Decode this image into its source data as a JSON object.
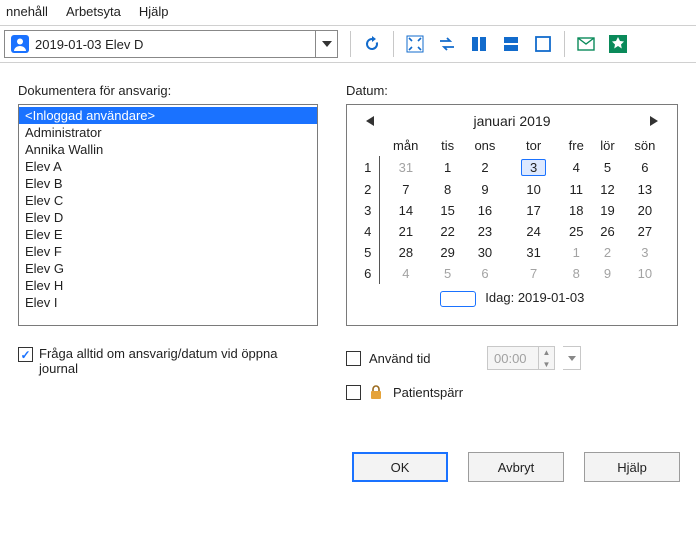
{
  "menubar": [
    "nnehåll",
    "Arbetsyta",
    "Hjälp"
  ],
  "toolbar": {
    "dropdown_text": "2019-01-03  Elev D"
  },
  "left": {
    "label": "Dokumentera för ansvarig:",
    "items": [
      "<Inloggad användare>",
      "Administrator",
      "Annika Wallin",
      "Elev A",
      "Elev B",
      "Elev C",
      "Elev D",
      "Elev E",
      "Elev F",
      "Elev G",
      "Elev H",
      "Elev I"
    ],
    "ask_always": "Fråga alltid om ansvarig/datum vid öppna journal"
  },
  "right": {
    "label": "Datum:",
    "month_title": "januari 2019",
    "days": [
      "mån",
      "tis",
      "ons",
      "tor",
      "fre",
      "lör",
      "sön"
    ],
    "weeks": [
      {
        "wk": 1,
        "d": [
          {
            "v": 31,
            "dim": true
          },
          {
            "v": 1
          },
          {
            "v": 2
          },
          {
            "v": 3,
            "sel": true
          },
          {
            "v": 4
          },
          {
            "v": 5
          },
          {
            "v": 6
          }
        ]
      },
      {
        "wk": 2,
        "d": [
          {
            "v": 7
          },
          {
            "v": 8
          },
          {
            "v": 9
          },
          {
            "v": 10
          },
          {
            "v": 11
          },
          {
            "v": 12
          },
          {
            "v": 13
          }
        ]
      },
      {
        "wk": 3,
        "d": [
          {
            "v": 14
          },
          {
            "v": 15
          },
          {
            "v": 16
          },
          {
            "v": 17
          },
          {
            "v": 18
          },
          {
            "v": 19
          },
          {
            "v": 20
          }
        ]
      },
      {
        "wk": 4,
        "d": [
          {
            "v": 21
          },
          {
            "v": 22
          },
          {
            "v": 23
          },
          {
            "v": 24
          },
          {
            "v": 25
          },
          {
            "v": 26
          },
          {
            "v": 27
          }
        ]
      },
      {
        "wk": 5,
        "d": [
          {
            "v": 28
          },
          {
            "v": 29
          },
          {
            "v": 30
          },
          {
            "v": 31
          },
          {
            "v": 1,
            "dim": true
          },
          {
            "v": 2,
            "dim": true
          },
          {
            "v": 3,
            "dim": true
          }
        ]
      },
      {
        "wk": 6,
        "d": [
          {
            "v": 4,
            "dim": true
          },
          {
            "v": 5,
            "dim": true
          },
          {
            "v": 6,
            "dim": true
          },
          {
            "v": 7,
            "dim": true
          },
          {
            "v": 8,
            "dim": true
          },
          {
            "v": 9,
            "dim": true
          },
          {
            "v": 10,
            "dim": true
          }
        ]
      }
    ],
    "today_label": "Idag: 2019-01-03",
    "use_time_label": "Använd tid",
    "time_value": "00:00",
    "patient_lock_label": "Patientspärr"
  },
  "buttons": {
    "ok": "OK",
    "cancel": "Avbryt",
    "help": "Hjälp"
  }
}
